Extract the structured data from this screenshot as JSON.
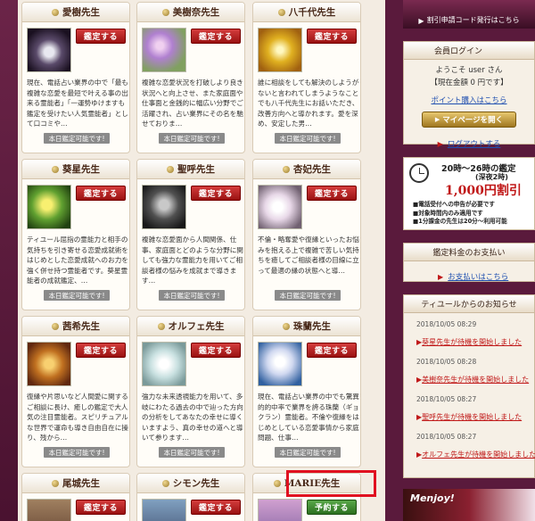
{
  "cards": [
    {
      "name": "愛樹先生",
      "button": "鑑定する",
      "desc": "現在、電話占い業界の中で「最も複雑な恋愛を最短で叶える事の出来る霊能者」「一運勢ゆけますも鑑定を受けたい人気霊能者」として口コミや…",
      "badge": "本日鑑定可能です!"
    },
    {
      "name": "美樹奈先生",
      "button": "鑑定する",
      "desc": "複雑な恋愛状況を打破しより良き状況へと向上させ、また家庭面や仕事面と金銭的に幅広い分野でご活躍され、占い業界にその名を馳せておりま…",
      "badge": "本日鑑定可能です!"
    },
    {
      "name": "八千代先生",
      "button": "鑑定する",
      "desc": "誰に相談をしても解決のしようがないと言われてしまうようなことでも八千代先生にお話いただき、改善方向へと導かれます。愛を深め、安定した男…",
      "badge": "本日鑑定可能です!"
    },
    {
      "name": "葵星先生",
      "button": "鑑定する",
      "desc": "ティユール屈指の霊能力と相手の気持ちを引き寄せる恋愛成就術をはじめとした恋愛成就へのお力を強く併せ持つ霊能者です。葵星霊能者の成就鑑定、…",
      "badge": "本日鑑定可能です!"
    },
    {
      "name": "聖呼先生",
      "button": "鑑定する",
      "desc": "複雑な恋愛面から人間関係、仕事、家庭面とどのような分野に関しても強力な霊能力を用いてご相談者様の悩みを成就まで導きます…",
      "badge": "本日鑑定可能です!"
    },
    {
      "name": "杏妃先生",
      "button": "鑑定する",
      "desc": "不倫・略奪愛や復縁といったお悩みを抱える上で複雑で苦しい気持ちを癒してご相談者様の目線に立って最適の縁の状態へと導…",
      "badge": "本日鑑定可能です!"
    },
    {
      "name": "茜希先生",
      "button": "鑑定する",
      "desc": "復縁や片思いなど人間愛に関するご相談に長け、癒しの鑑定で大人気の注目霊能者。スピリチュアルな世界で運命も導き自由自在に操り、残から…",
      "badge": "本日鑑定可能です!"
    },
    {
      "name": "オルフェ先生",
      "button": "鑑定する",
      "desc": "強力な未来透視能力を用いて、多岐にわたる過去の中で辿った方向の分析をしてあなたの幸せに導くいますよう、真の幸せの道へと導いて参ります…",
      "badge": "本日鑑定可能です!"
    },
    {
      "name": "珠蘭先生",
      "button": "鑑定する",
      "desc": "現在、電話占い業界の中でも驚異的的中率で業界を誇る珠蘭（ギョクラン）霊能者。不倫や復縁をはじめとしている恋愛事情から家庭問題、仕事…",
      "badge": "本日鑑定可能です!"
    },
    {
      "name": "尾城先生",
      "button": "鑑定する",
      "desc": "",
      "badge": ""
    },
    {
      "name": "シモン先生",
      "button": "鑑定する",
      "desc": "",
      "badge": ""
    },
    {
      "name": "MARIE先生",
      "button": "予約する",
      "desc": "",
      "badge": ""
    }
  ],
  "sidebar": {
    "banner_top": "割引申請コード発行はこちら",
    "login": {
      "title": "会員ログイン",
      "welcome": "ようこそ user さん",
      "balance": "【現在金額 0 円です】",
      "points_link": "ポイント購入はこちら",
      "mypage_button": "マイページを開く",
      "logout": "ログアウトする"
    },
    "discount": {
      "time": "20時～26時の鑑定",
      "sub": "(深夜2時)",
      "amount": "1,000円割引",
      "notes": [
        "電話受付への申告が必要です",
        "対象時間内のみ適用です",
        "1分課金の先生は20分～利用可能"
      ]
    },
    "payment": {
      "title": "鑑定料金のお支払い",
      "link": "お支払いはこちら"
    },
    "news": {
      "title": "ティユールからのお知らせ",
      "items": [
        {
          "date": "2018/10/05 08:29",
          "text": "葵星先生が待機を開始しました"
        },
        {
          "date": "2018/10/05 08:28",
          "text": "美樹奈先生が待機を開始しました"
        },
        {
          "date": "2018/10/05 08:27",
          "text": "聖呼先生が待機を開始しました"
        },
        {
          "date": "2018/10/05 08:27",
          "text": "オルフェ先生が待機を開始しました"
        }
      ]
    },
    "ad": "Menjoy!"
  },
  "colors": {
    "brand": "#5a1a3c",
    "button": "#b51f1f",
    "reserve": "#3f8a30",
    "highlight": "#e01020"
  }
}
